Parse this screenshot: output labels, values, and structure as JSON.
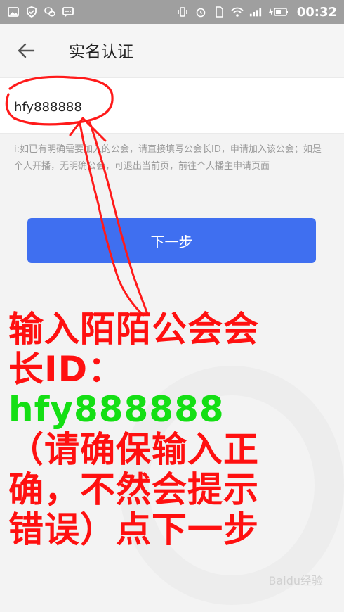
{
  "status_bar": {
    "time": "00:32",
    "left_icons": [
      "image-icon",
      "shield-check-icon",
      "wechat-icon",
      "message-icon"
    ],
    "right_icons": [
      "vibrate-icon",
      "alarm-icon",
      "sim-icon",
      "wifi-icon",
      "signal-icon",
      "charging-battery-icon"
    ]
  },
  "app_bar": {
    "title": "实名认证"
  },
  "input": {
    "value": "hfy888888"
  },
  "hint_text": "i:如已有明确需要加入的公会，请直接填写公会长ID，申请加入该公会；如是个人开播，无明确公会，可退出当前页，前往个人播主申请页面",
  "next_button": {
    "label": "下一步"
  },
  "overlay": {
    "line1": "输入陌陌公会会",
    "line2_prefix": "长ID：",
    "line2_value": "hfy888888",
    "line3": "（请确保输入正",
    "line4": "确，不然会提示",
    "line5": "错误）点下一步"
  },
  "watermark": {
    "text": "Baidu经验"
  },
  "colors": {
    "accent": "#3f6ff0",
    "annotation_red": "#ff1010",
    "annotation_green": "#14df14"
  }
}
